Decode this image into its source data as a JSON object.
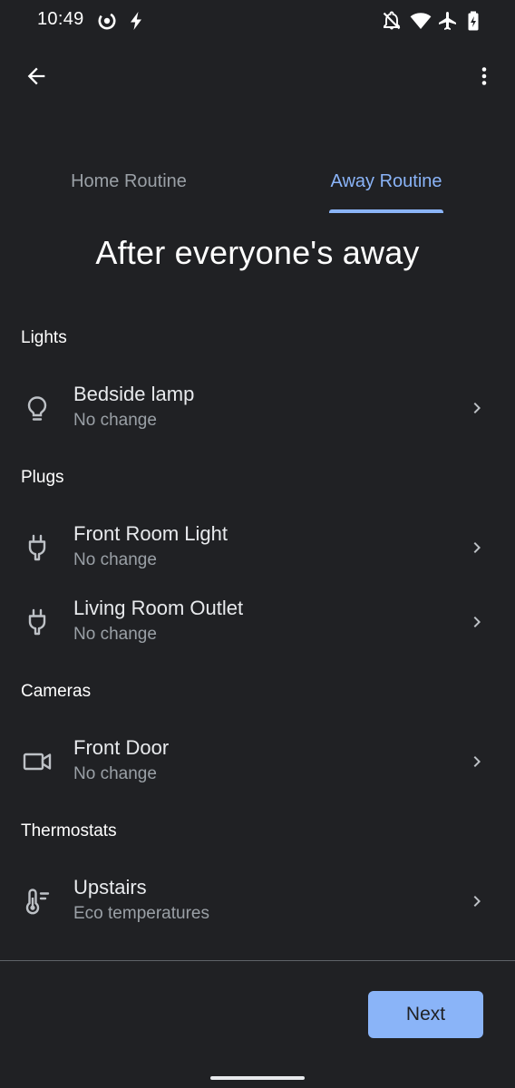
{
  "status_bar": {
    "time": "10:49",
    "left_icons": [
      "data-saver-icon",
      "flash-icon"
    ],
    "right_icons": [
      "notifications-off-icon",
      "wifi-icon",
      "airplane-icon",
      "battery-charging-icon"
    ]
  },
  "app_bar": {
    "back_icon": "arrow-back-icon",
    "more_icon": "more-vert-icon"
  },
  "tabs": [
    {
      "label": "Home Routine",
      "selected": false
    },
    {
      "label": "Away Routine",
      "selected": true
    }
  ],
  "title": "After everyone's away",
  "sections": [
    {
      "header": "Lights",
      "items": [
        {
          "icon": "lightbulb-icon",
          "title": "Bedside lamp",
          "subtitle": "No change"
        }
      ]
    },
    {
      "header": "Plugs",
      "items": [
        {
          "icon": "plug-icon",
          "title": "Front Room Light",
          "subtitle": "No change"
        },
        {
          "icon": "plug-icon",
          "title": "Living Room Outlet",
          "subtitle": "No change"
        }
      ]
    },
    {
      "header": "Cameras",
      "items": [
        {
          "icon": "camera-icon",
          "title": "Front Door",
          "subtitle": "No change"
        }
      ]
    },
    {
      "header": "Thermostats",
      "items": [
        {
          "icon": "thermostat-icon",
          "title": "Upstairs",
          "subtitle": "Eco temperatures"
        }
      ]
    }
  ],
  "footer": {
    "next_label": "Next"
  },
  "colors": {
    "background": "#202124",
    "accent": "#8ab4f8",
    "primary_text": "#e8eaed",
    "secondary_text": "#9aa0a6"
  }
}
